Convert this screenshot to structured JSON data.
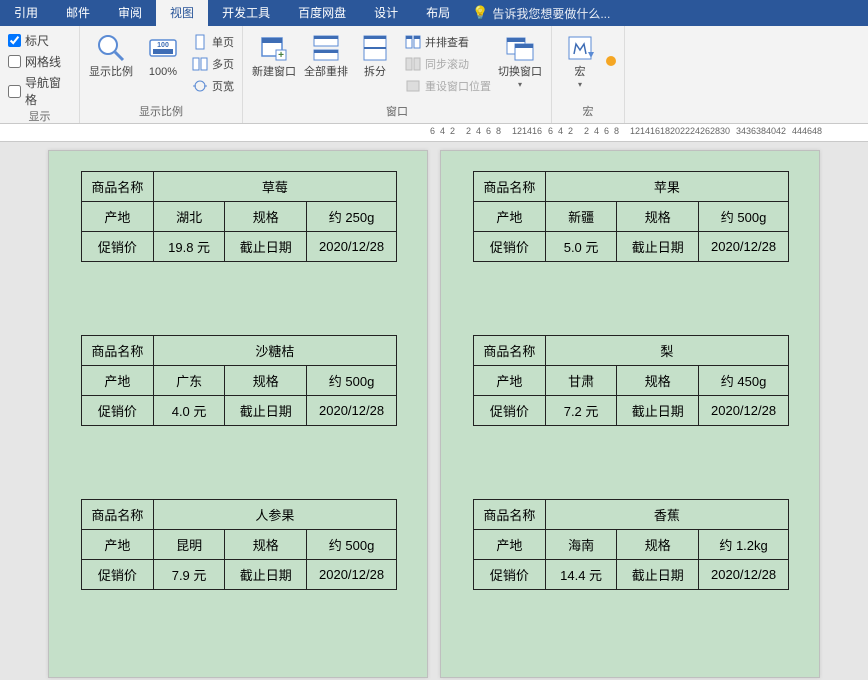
{
  "tabs": [
    "引用",
    "邮件",
    "审阅",
    "视图",
    "开发工具",
    "百度网盘",
    "设计",
    "布局"
  ],
  "activeTab": "视图",
  "tellme_placeholder": "告诉我您想要做什么...",
  "group_display": {
    "label": "显示",
    "chks": [
      {
        "label": "标尺",
        "checked": true
      },
      {
        "label": "网格线",
        "checked": false
      },
      {
        "label": "导航窗格",
        "checked": false
      }
    ]
  },
  "group_zoom": {
    "label": "显示比例",
    "big1": "显示比例",
    "big2": "100%",
    "small": [
      "单页",
      "多页",
      "页宽"
    ]
  },
  "group_window": {
    "label": "窗口",
    "newwin": "新建窗口",
    "rearr": "全部重排",
    "split": "拆分",
    "side": "并排查看",
    "sync": "同步滚动",
    "reset": "重设窗口位置",
    "switch": "切换窗口"
  },
  "group_macro": {
    "label": "宏",
    "btn": "宏"
  },
  "labels": {
    "name": "商品名称",
    "origin": "产地",
    "spec": "规格",
    "price": "促销价",
    "deadline": "截止日期"
  },
  "products_left": [
    {
      "name": "草莓",
      "origin": "湖北",
      "spec": "约 250g",
      "price": "19.8 元",
      "deadline": "2020/12/28"
    },
    {
      "name": "沙糖桔",
      "origin": "广东",
      "spec": "约 500g",
      "price": "4.0 元",
      "deadline": "2020/12/28"
    },
    {
      "name": "人参果",
      "origin": "昆明",
      "spec": "约 500g",
      "price": "7.9 元",
      "deadline": "2020/12/28"
    }
  ],
  "products_right": [
    {
      "name": "苹果",
      "origin": "新疆",
      "spec": "约 500g",
      "price": "5.0 元",
      "deadline": "2020/12/28"
    },
    {
      "name": "梨",
      "origin": "甘肃",
      "spec": "约 450g",
      "price": "7.2 元",
      "deadline": "2020/12/28"
    },
    {
      "name": "香蕉",
      "origin": "海南",
      "spec": "约 1.2kg",
      "price": "14.4 元",
      "deadline": "2020/12/28"
    }
  ],
  "ruler_nums": [
    6,
    4,
    2,
    "",
    2,
    4,
    6,
    8,
    "",
    12,
    14,
    16,
    "",
    6,
    4,
    2,
    "",
    2,
    4,
    6,
    8,
    "",
    12,
    14,
    16,
    18,
    20,
    22,
    24,
    26,
    28,
    30,
    "",
    34,
    36,
    38,
    40,
    42,
    "",
    44,
    46,
    48
  ]
}
